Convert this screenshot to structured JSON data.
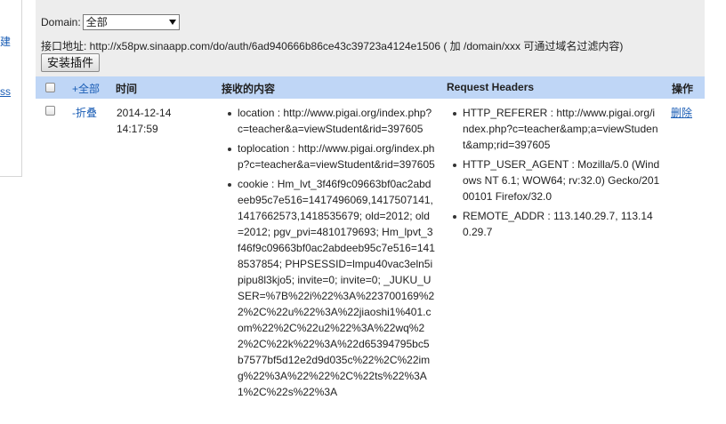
{
  "sidebar": {
    "link1": "建",
    "link2": "ss"
  },
  "toolbar": {
    "domain_label": "Domain:",
    "domain_value": "全部",
    "api_text": "接口地址: http://x58pw.sinaapp.com/do/auth/6ad940666b86ce43c39723a4124e1506 ( 加 /domain/xxx 可通过域名过滤内容)",
    "install_label": "安装插件"
  },
  "table": {
    "headers": {
      "all": "+全部",
      "time": "时间",
      "content": "接收的内容",
      "request_headers": "Request Headers",
      "operation": "操作"
    },
    "row": {
      "fold": "-折叠",
      "date": "2014-12-14",
      "time": "14:17:59",
      "content": [
        "location : http://www.pigai.org/index.php?c=teacher&a=viewStudent&rid=397605",
        "toplocation : http://www.pigai.org/index.php?c=teacher&a=viewStudent&rid=397605",
        "cookie : Hm_lvt_3f46f9c09663bf0ac2abdeeb95c7e516=1417496069,1417507141,1417662573,1418535679; old=2012; old=2012; pgv_pvi=4810179693; Hm_lpvt_3f46f9c09663bf0ac2abdeeb95c7e516=1418537854; PHPSESSID=lmpu40vac3eln5ipipu8l3kjo5; invite=0; invite=0; _JUKU_USER=%7B%22i%22%3A%223700169%22%2C%22u%22%3A%22jiaoshi1%401.com%22%2C%22u2%22%3A%22wq%22%2C%22k%22%3A%22d65394795bc5b7577bf5d12e2d9d035c%22%2C%22img%22%3A%22%22%2C%22ts%22%3A1%2C%22s%22%3A"
      ],
      "headers": [
        "HTTP_REFERER : http://www.pigai.org/index.php?c=teacher&amp;a=viewStudent&amp;rid=397605",
        "HTTP_USER_AGENT : Mozilla/5.0 (Windows NT 6.1; WOW64; rv:32.0) Gecko/20100101 Firefox/32.0",
        "REMOTE_ADDR : 113.140.29.7, 113.140.29.7"
      ],
      "delete_label": "删除"
    }
  },
  "colors": {
    "header_bg": "#bfd6f6",
    "toolbar_bg": "#ededed",
    "link": "#1a5db5"
  }
}
